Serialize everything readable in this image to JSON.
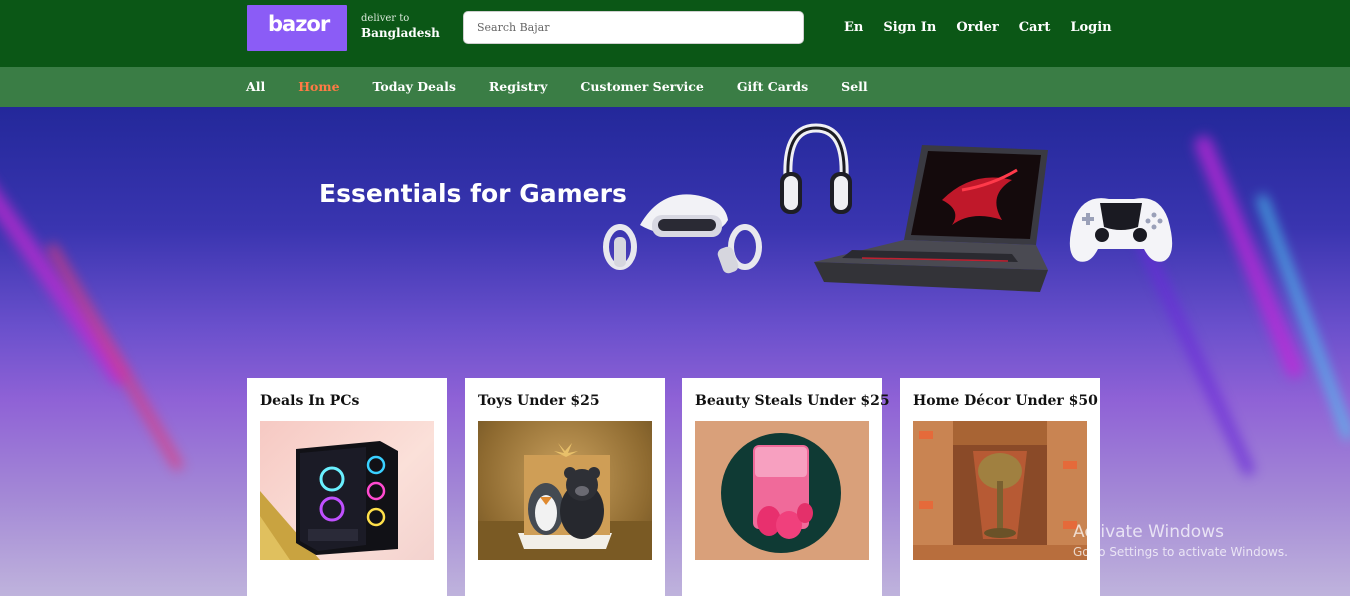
{
  "header": {
    "logo_text": "bazor",
    "deliver_label": "deliver to",
    "deliver_country": "Bangladesh",
    "search_placeholder": "Search Bajar",
    "links": [
      "En",
      "Sign In",
      "Order",
      "Cart",
      "Login"
    ]
  },
  "nav": {
    "items": [
      "All",
      "Home",
      "Today Deals",
      "Registry",
      "Customer Service",
      "Gift Cards",
      "Sell"
    ],
    "active": "Home"
  },
  "hero": {
    "title": "Essentials for Gamers"
  },
  "cards": [
    {
      "title": "Deals In PCs",
      "image": "gaming-pc-image"
    },
    {
      "title": "Toys Under $25",
      "image": "plush-toys-image"
    },
    {
      "title": "Beauty Steals Under $25",
      "image": "makeup-blender-image"
    },
    {
      "title": "Home Décor Under $50",
      "image": "table-lamp-image"
    }
  ],
  "watermark": {
    "line1": "Activate Windows",
    "line2": "Go to Settings to activate Windows."
  },
  "colors": {
    "header_bg": "#0b5716",
    "nav_bg": "#3a7d45",
    "logo_bg": "#8b5cf6",
    "active_nav": "#ff7a45"
  }
}
